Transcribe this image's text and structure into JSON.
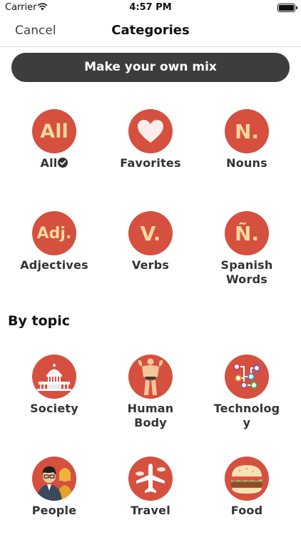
{
  "status_bar": {
    "carrier": "Carrier",
    "time": "4:57 PM"
  },
  "nav": {
    "cancel_label": "Cancel",
    "title": "Categories"
  },
  "mix_button_label": "Make your own mix",
  "categories": [
    {
      "label": "All",
      "icon_text": "All",
      "selected": true
    },
    {
      "label": "Favorites",
      "icon": "heart-icon"
    },
    {
      "label": "Nouns",
      "icon_text": "N."
    },
    {
      "label": "Adjectives",
      "icon_text": "Adj."
    },
    {
      "label": "Verbs",
      "icon_text": "V."
    },
    {
      "label": "Spanish Words",
      "label_line1": "Spanish",
      "label_line2": "Words",
      "icon_text": "Ñ."
    }
  ],
  "section_title": "By topic",
  "topics": [
    {
      "label": "Society",
      "icon": "capitol-building-icon"
    },
    {
      "label": "Human Body",
      "label_line1": "Human",
      "label_line2": "Body",
      "icon": "bodybuilder-icon"
    },
    {
      "label": "Technology",
      "label_line1": "Technolog",
      "label_line2": "y",
      "icon": "circuit-icon"
    },
    {
      "label": "People",
      "icon": "people-icon"
    },
    {
      "label": "Travel",
      "icon": "airplane-icon"
    },
    {
      "label": "Food",
      "icon": "burger-icon"
    }
  ],
  "colors": {
    "accent": "#d5503f",
    "icon_text": "#f7d7a0",
    "button_bg": "#3d3d3d"
  }
}
